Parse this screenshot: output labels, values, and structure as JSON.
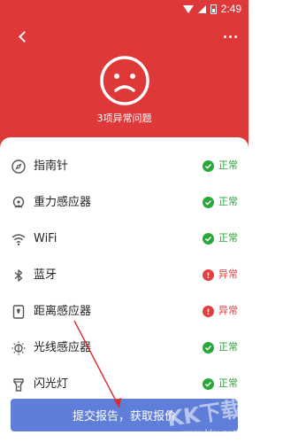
{
  "status_bar": {
    "time": "2:49"
  },
  "header": {
    "subtitle": "3项异常问题",
    "theme_color": "#de3838"
  },
  "items": [
    {
      "label": "指南针",
      "status": "正常",
      "state": "ok",
      "icon": "compass-icon"
    },
    {
      "label": "重力感应器",
      "status": "正常",
      "state": "ok",
      "icon": "gravity-sensor-icon"
    },
    {
      "label": "WiFi",
      "status": "正常",
      "state": "ok",
      "icon": "wifi-icon"
    },
    {
      "label": "蓝牙",
      "status": "异常",
      "state": "bad",
      "icon": "bluetooth-icon"
    },
    {
      "label": "距离感应器",
      "status": "异常",
      "state": "bad",
      "icon": "proximity-sensor-icon"
    },
    {
      "label": "光线感应器",
      "status": "正常",
      "state": "ok",
      "icon": "light-sensor-icon"
    },
    {
      "label": "闪光灯",
      "status": "正常",
      "state": "ok",
      "icon": "flashlight-icon"
    }
  ],
  "cta": {
    "label": "提交报告，获取报价",
    "color": "#5f7ed9"
  },
  "watermark": {
    "text": "KK下载",
    "url": "www.kkx.net"
  },
  "colors": {
    "ok": "#27a838",
    "bad": "#e24040"
  }
}
